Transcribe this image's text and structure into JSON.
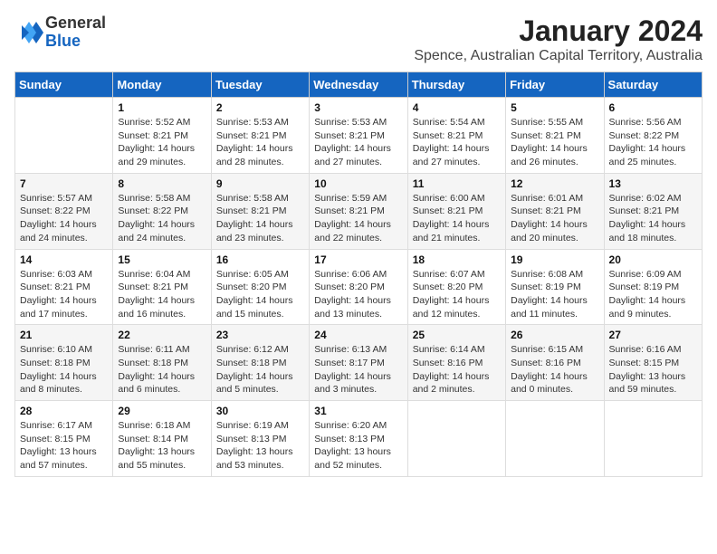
{
  "logo": {
    "general": "General",
    "blue": "Blue"
  },
  "title": "January 2024",
  "location": "Spence, Australian Capital Territory, Australia",
  "days_header": [
    "Sunday",
    "Monday",
    "Tuesday",
    "Wednesday",
    "Thursday",
    "Friday",
    "Saturday"
  ],
  "weeks": [
    [
      {
        "day": "",
        "info": ""
      },
      {
        "day": "1",
        "info": "Sunrise: 5:52 AM\nSunset: 8:21 PM\nDaylight: 14 hours\nand 29 minutes."
      },
      {
        "day": "2",
        "info": "Sunrise: 5:53 AM\nSunset: 8:21 PM\nDaylight: 14 hours\nand 28 minutes."
      },
      {
        "day": "3",
        "info": "Sunrise: 5:53 AM\nSunset: 8:21 PM\nDaylight: 14 hours\nand 27 minutes."
      },
      {
        "day": "4",
        "info": "Sunrise: 5:54 AM\nSunset: 8:21 PM\nDaylight: 14 hours\nand 27 minutes."
      },
      {
        "day": "5",
        "info": "Sunrise: 5:55 AM\nSunset: 8:21 PM\nDaylight: 14 hours\nand 26 minutes."
      },
      {
        "day": "6",
        "info": "Sunrise: 5:56 AM\nSunset: 8:22 PM\nDaylight: 14 hours\nand 25 minutes."
      }
    ],
    [
      {
        "day": "7",
        "info": "Sunrise: 5:57 AM\nSunset: 8:22 PM\nDaylight: 14 hours\nand 24 minutes."
      },
      {
        "day": "8",
        "info": "Sunrise: 5:58 AM\nSunset: 8:22 PM\nDaylight: 14 hours\nand 24 minutes."
      },
      {
        "day": "9",
        "info": "Sunrise: 5:58 AM\nSunset: 8:21 PM\nDaylight: 14 hours\nand 23 minutes."
      },
      {
        "day": "10",
        "info": "Sunrise: 5:59 AM\nSunset: 8:21 PM\nDaylight: 14 hours\nand 22 minutes."
      },
      {
        "day": "11",
        "info": "Sunrise: 6:00 AM\nSunset: 8:21 PM\nDaylight: 14 hours\nand 21 minutes."
      },
      {
        "day": "12",
        "info": "Sunrise: 6:01 AM\nSunset: 8:21 PM\nDaylight: 14 hours\nand 20 minutes."
      },
      {
        "day": "13",
        "info": "Sunrise: 6:02 AM\nSunset: 8:21 PM\nDaylight: 14 hours\nand 18 minutes."
      }
    ],
    [
      {
        "day": "14",
        "info": "Sunrise: 6:03 AM\nSunset: 8:21 PM\nDaylight: 14 hours\nand 17 minutes."
      },
      {
        "day": "15",
        "info": "Sunrise: 6:04 AM\nSunset: 8:21 PM\nDaylight: 14 hours\nand 16 minutes."
      },
      {
        "day": "16",
        "info": "Sunrise: 6:05 AM\nSunset: 8:20 PM\nDaylight: 14 hours\nand 15 minutes."
      },
      {
        "day": "17",
        "info": "Sunrise: 6:06 AM\nSunset: 8:20 PM\nDaylight: 14 hours\nand 13 minutes."
      },
      {
        "day": "18",
        "info": "Sunrise: 6:07 AM\nSunset: 8:20 PM\nDaylight: 14 hours\nand 12 minutes."
      },
      {
        "day": "19",
        "info": "Sunrise: 6:08 AM\nSunset: 8:19 PM\nDaylight: 14 hours\nand 11 minutes."
      },
      {
        "day": "20",
        "info": "Sunrise: 6:09 AM\nSunset: 8:19 PM\nDaylight: 14 hours\nand 9 minutes."
      }
    ],
    [
      {
        "day": "21",
        "info": "Sunrise: 6:10 AM\nSunset: 8:18 PM\nDaylight: 14 hours\nand 8 minutes."
      },
      {
        "day": "22",
        "info": "Sunrise: 6:11 AM\nSunset: 8:18 PM\nDaylight: 14 hours\nand 6 minutes."
      },
      {
        "day": "23",
        "info": "Sunrise: 6:12 AM\nSunset: 8:18 PM\nDaylight: 14 hours\nand 5 minutes."
      },
      {
        "day": "24",
        "info": "Sunrise: 6:13 AM\nSunset: 8:17 PM\nDaylight: 14 hours\nand 3 minutes."
      },
      {
        "day": "25",
        "info": "Sunrise: 6:14 AM\nSunset: 8:16 PM\nDaylight: 14 hours\nand 2 minutes."
      },
      {
        "day": "26",
        "info": "Sunrise: 6:15 AM\nSunset: 8:16 PM\nDaylight: 14 hours\nand 0 minutes."
      },
      {
        "day": "27",
        "info": "Sunrise: 6:16 AM\nSunset: 8:15 PM\nDaylight: 13 hours\nand 59 minutes."
      }
    ],
    [
      {
        "day": "28",
        "info": "Sunrise: 6:17 AM\nSunset: 8:15 PM\nDaylight: 13 hours\nand 57 minutes."
      },
      {
        "day": "29",
        "info": "Sunrise: 6:18 AM\nSunset: 8:14 PM\nDaylight: 13 hours\nand 55 minutes."
      },
      {
        "day": "30",
        "info": "Sunrise: 6:19 AM\nSunset: 8:13 PM\nDaylight: 13 hours\nand 53 minutes."
      },
      {
        "day": "31",
        "info": "Sunrise: 6:20 AM\nSunset: 8:13 PM\nDaylight: 13 hours\nand 52 minutes."
      },
      {
        "day": "",
        "info": ""
      },
      {
        "day": "",
        "info": ""
      },
      {
        "day": "",
        "info": ""
      }
    ]
  ]
}
